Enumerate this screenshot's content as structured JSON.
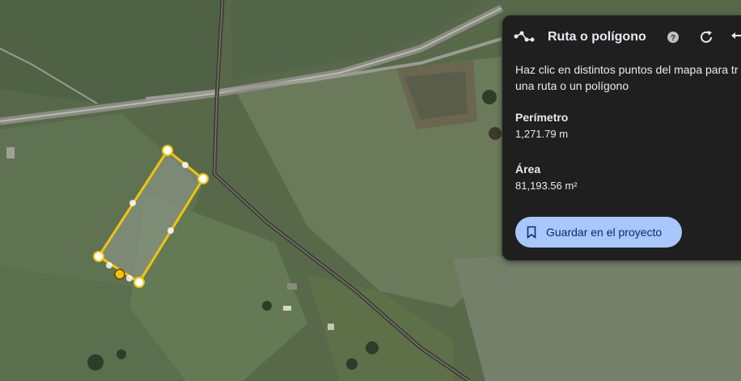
{
  "panel": {
    "title": "Ruta o polígono",
    "header_icons": [
      "route-icon",
      "help-icon",
      "refresh-icon",
      "undo-icon"
    ],
    "instructions_line1": "Haz clic en distintos puntos del mapa para tr",
    "instructions_line2": "una ruta o un polígono",
    "perimeter_label": "Perímetro",
    "perimeter_value": "1,271.79 m",
    "area_label": "Área",
    "area_value": "81,193.56 m²",
    "save_label": "Guardar en el proyecto",
    "save_icon": "bookmark-icon"
  },
  "colors": {
    "panel_bg": "#1f1f1f",
    "panel_text": "#e8eaed",
    "button_bg": "#a8c7fa",
    "button_text": "#062e6f",
    "polygon_stroke": "#f4c20d"
  }
}
